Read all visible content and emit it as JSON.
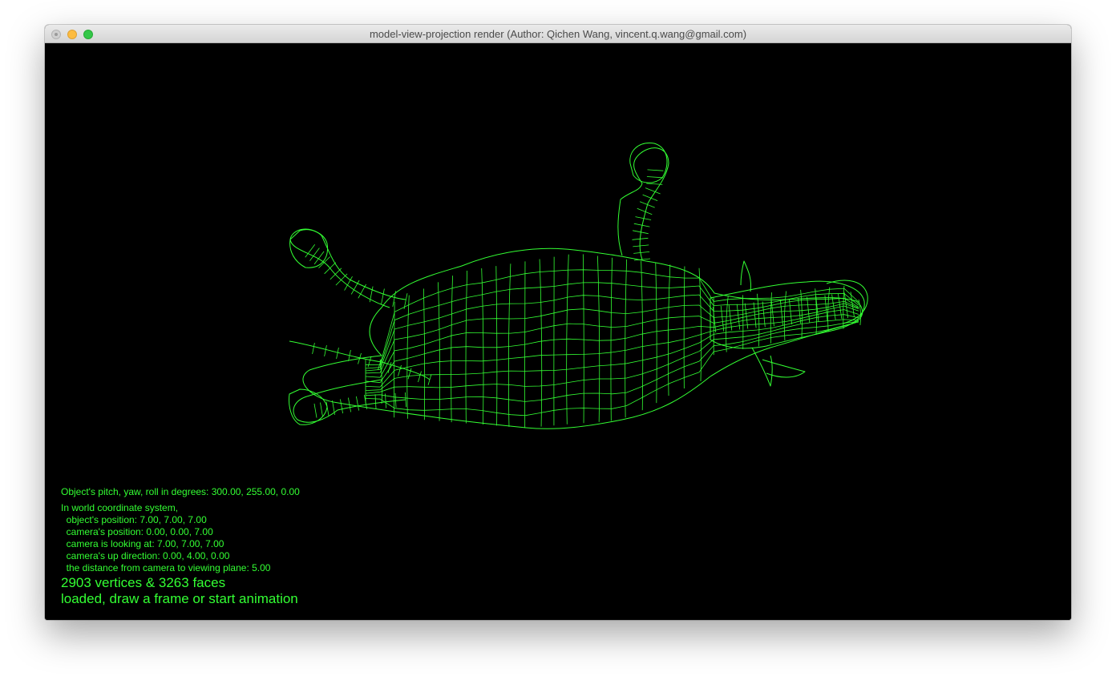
{
  "window": {
    "title": "model-view-projection render (Author: Qichen Wang, vincent.q.wang@gmail.com)"
  },
  "render": {
    "wire_color": "#33ff33",
    "background_color": "#000000"
  },
  "info": {
    "rotation": "Object's pitch, yaw, roll in degrees: 300.00, 255.00, 0.00",
    "coord_header": "In world coordinate system,",
    "object_position": "  object's position: 7.00, 7.00, 7.00",
    "camera_position": "  camera's position: 0.00, 0.00, 7.00",
    "camera_looking_at": "  camera is looking at: 7.00, 7.00, 7.00",
    "camera_up": "  camera's up direction: 0.00, 4.00, 0.00",
    "viewing_distance": "  the distance from camera to viewing plane: 5.00",
    "counts": "2903 vertices & 3263 faces",
    "status": "loaded, draw a frame or start animation"
  }
}
